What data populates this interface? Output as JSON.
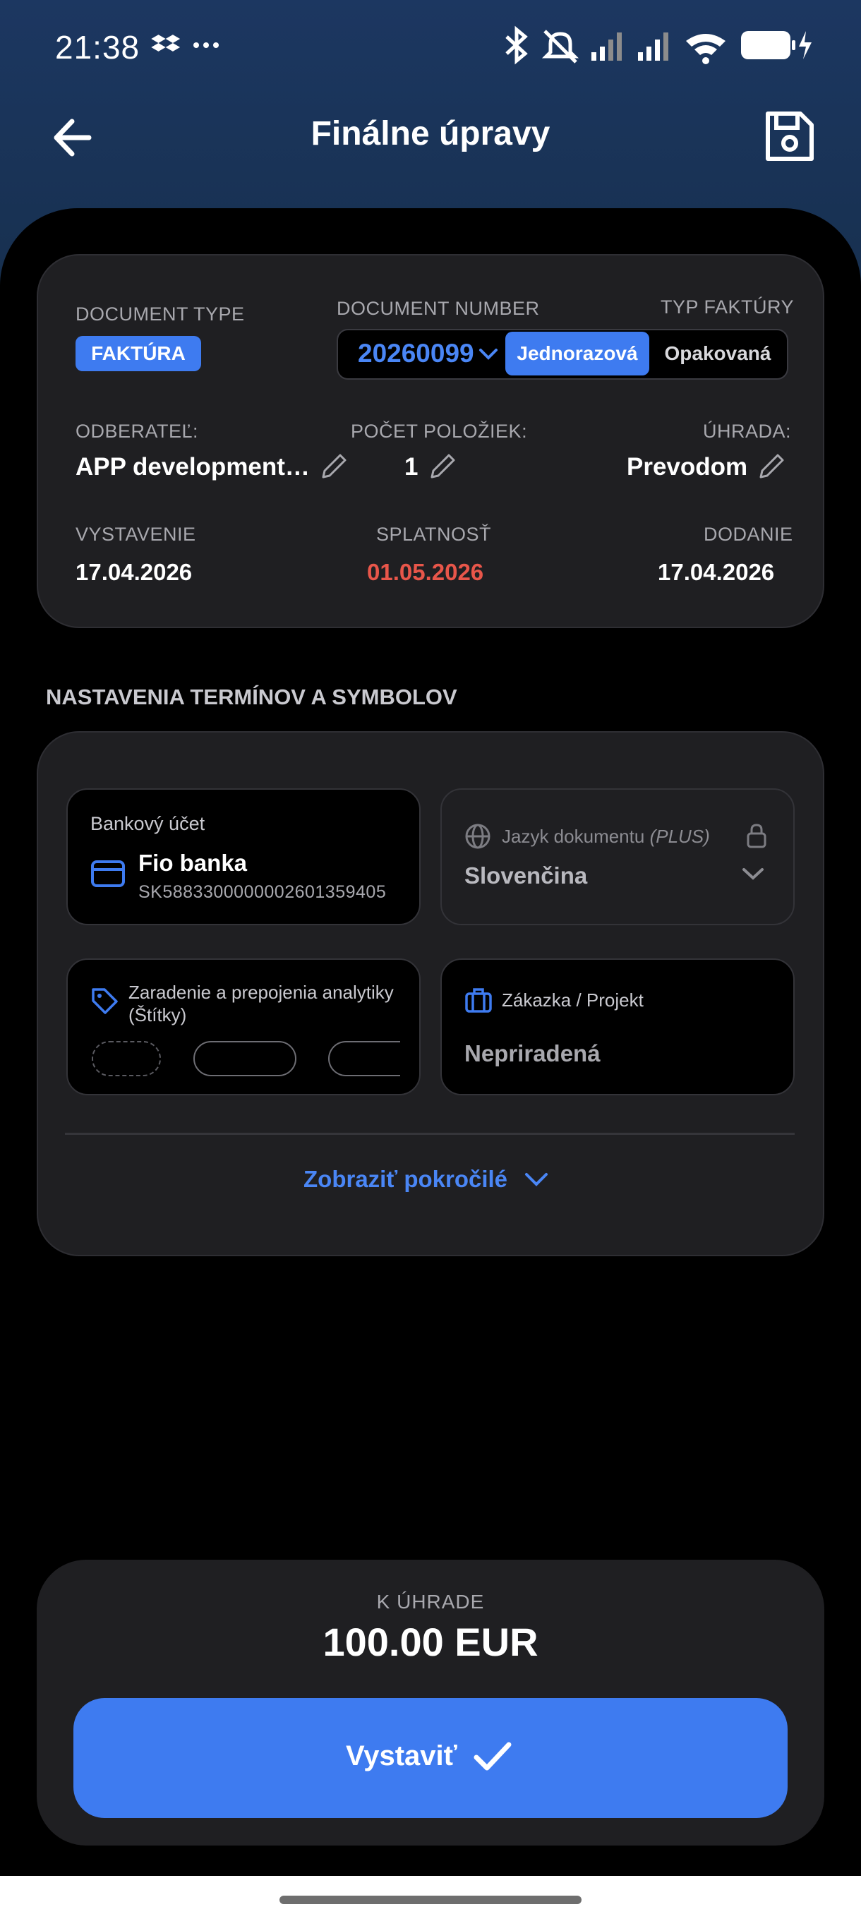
{
  "status_bar": {
    "time": "21:38"
  },
  "app_bar": {
    "title": "Finálne úpravy"
  },
  "summary": {
    "document_type_label": "DOCUMENT TYPE",
    "document_type_value": "FAKTÚRA",
    "document_number_label": "DOCUMENT NUMBER",
    "document_number_value": "20260099",
    "invoice_type_label": "TYP FAKTÚRY",
    "invoice_type_options": [
      "Jednorazová",
      "Opakovaná"
    ],
    "invoice_type_selected": "Jednorazová",
    "customer_label": "ODBERATEĽ:",
    "customer_value": "APP development…",
    "items_label": "POČET POLOŽIEK:",
    "items_value": "1",
    "payment_label": "ÚHRADA:",
    "payment_value": "Prevodom",
    "issue_label": "VYSTAVENIE",
    "issue_value": "17.04.2026",
    "due_label": "SPLATNOSŤ",
    "due_value": "01.05.2026",
    "delivery_label": "DODANIE",
    "delivery_value": "17.04.2026",
    "colors": {
      "accent": "#3e7bf0",
      "due": "#e8564a"
    }
  },
  "settings": {
    "section_title": "NASTAVENIA TERMÍNOV A SYMBOLOV",
    "bank": {
      "label": "Bankový účet",
      "name": "Fio banka",
      "iban": "SK5883300000002601359405"
    },
    "language": {
      "label": "Jazyk dokumentu",
      "badge": "(PLUS)",
      "value": "Slovenčina"
    },
    "tags": {
      "label_line1": "Zaradenie a prepojenia analytiky",
      "label_line2": "(Štítky)"
    },
    "project": {
      "label": "Zákazka / Projekt",
      "value": "Nepriradená"
    },
    "advanced_label": "Zobraziť pokročilé"
  },
  "footer": {
    "total_label": "K ÚHRADE",
    "total_value": "100.00 EUR",
    "submit_label": "Vystaviť"
  }
}
